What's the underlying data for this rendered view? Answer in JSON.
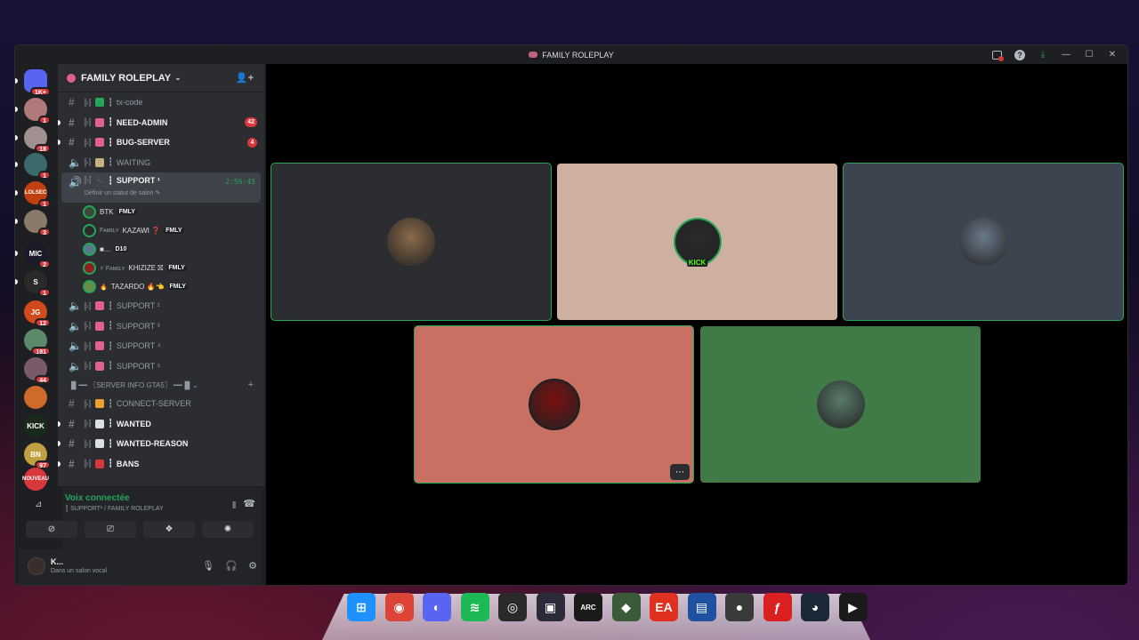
{
  "window": {
    "title": "FAMILY ROLEPLAY"
  },
  "servers": [
    {
      "name": "discord-home",
      "badge": "1K+",
      "color": "#5865f2",
      "label": ""
    },
    {
      "name": "server-1",
      "badge": "1",
      "color": "#b07a7a",
      "label": ""
    },
    {
      "name": "server-2",
      "badge": "18",
      "color": "#a09090",
      "label": ""
    },
    {
      "name": "server-3",
      "badge": "1",
      "color": "#3a6a6a",
      "label": ""
    },
    {
      "name": "server-lolsec",
      "badge": "1",
      "color": "#c04010",
      "label": "LOLSEC"
    },
    {
      "name": "server-5",
      "badge": "3",
      "color": "#8a7a6a",
      "label": ""
    },
    {
      "name": "server-mic",
      "badge": "2",
      "color": "#1a1a2a",
      "label": "MIC"
    },
    {
      "name": "server-s",
      "badge": "1",
      "color": "#2a2a2a",
      "label": "S"
    },
    {
      "name": "server-jg",
      "badge": "12",
      "color": "#d04a1a",
      "label": "JG"
    },
    {
      "name": "server-191",
      "badge": "191",
      "color": "#5a8a6a",
      "label": ""
    },
    {
      "name": "server-44",
      "badge": "44",
      "color": "#7a5a6a",
      "label": ""
    },
    {
      "name": "server-12",
      "badge": "",
      "color": "#d06a2a",
      "label": ""
    },
    {
      "name": "server-kick",
      "badge": "",
      "color": "#1a2a1a",
      "label": "KICK"
    },
    {
      "name": "server-97",
      "badge": "97",
      "color": "#c0a040",
      "label": "BN"
    },
    {
      "name": "server-nouveau",
      "badge": "",
      "color": "#da373c",
      "label": "NOUVEAU"
    }
  ],
  "sidebar": {
    "server_name": "FAMILY ROLEPLAY",
    "channels": [
      {
        "name": "tx-code",
        "type": "text",
        "bold": false,
        "emoji_color": "#23a55a",
        "count": ""
      },
      {
        "name": "NEED-ADMIN",
        "type": "text",
        "bold": true,
        "emoji_color": "#e06090",
        "count": "42"
      },
      {
        "name": "BUG-SERVER",
        "type": "text",
        "bold": true,
        "emoji_color": "#e06090",
        "count": "4"
      },
      {
        "name": "WAITING",
        "type": "voice",
        "bold": false,
        "emoji_color": "#c8b080",
        "count": ""
      }
    ],
    "active_channel": {
      "name": "SUPPORT ¹",
      "timer": "2:56:45",
      "status": "Définir un statut de salon ✎"
    },
    "voice_users": [
      {
        "name": "BTK",
        "tag": "FMLY",
        "color": "#3a4a3a"
      },
      {
        "name": "KAZAWI ❓",
        "prefix": "Fᴀᴍɪʟʏ",
        "tag": "FMLY",
        "color": "#2a2a2a"
      },
      {
        "name": "■...",
        "tag": "D10",
        "color": "#5a7a8a"
      },
      {
        "name": "KHIZIZE ⛝",
        "prefix": "⚡ Fᴀᴍɪʟʏ",
        "tag": "FMLY",
        "color": "#8a2020"
      },
      {
        "name": "TAZARDO 🔥👈",
        "prefix": "🔥",
        "tag": "FMLY",
        "color": "#6a8a4a"
      }
    ],
    "support_channels": [
      "SUPPORT ²",
      "SUPPORT ³",
      "SUPPORT ⁴",
      "SUPPORT ⁵"
    ],
    "category": "▐▌━━ 〖SERVER INFO GTA5〗 ━━▐▌",
    "info_channels": [
      {
        "name": "CONNECT-SERVER",
        "bold": false,
        "emoji_color": "#e8a030"
      },
      {
        "name": "WANTED",
        "bold": true,
        "emoji_color": "#dbdee1"
      },
      {
        "name": "WANTED-REASON",
        "bold": true,
        "emoji_color": "#dbdee1"
      },
      {
        "name": "BANS",
        "bold": true,
        "emoji_color": "#da373c"
      }
    ]
  },
  "voice_panel": {
    "title": "Voix connectée",
    "subtitle": "┇ SUPPORT¹ / FAMILY ROLEPLAY"
  },
  "user": {
    "name": "K...",
    "status": "Dans un salon vocal"
  },
  "tiles": [
    {
      "name": "tile-1",
      "bg": "#2b2d31",
      "speaking": true,
      "avatar_color": "#8a6a4a",
      "badge": ""
    },
    {
      "name": "tile-2",
      "bg": "#cdb0a0",
      "speaking": false,
      "avatar_color": "#2a2a2a",
      "badge": "KICK"
    },
    {
      "name": "tile-3",
      "bg": "#3c4450",
      "speaking": true,
      "avatar_color": "#6a7a8a",
      "badge": ""
    },
    {
      "name": "tile-4",
      "bg": "#c87062",
      "speaking": true,
      "avatar_color": "#7a1010",
      "badge": ""
    },
    {
      "name": "tile-5",
      "bg": "#3f7a47",
      "speaking": false,
      "avatar_color": "#5a7a6a",
      "badge": ""
    }
  ],
  "taskbar": [
    {
      "name": "windows-start-icon",
      "color": "#1e90ff",
      "glyph": "⊞"
    },
    {
      "name": "chrome-icon",
      "color": "#db4437",
      "glyph": "◉"
    },
    {
      "name": "discord-icon",
      "color": "#5865f2",
      "glyph": "◐"
    },
    {
      "name": "spotify-icon",
      "color": "#1db954",
      "glyph": "≋"
    },
    {
      "name": "obs-icon",
      "color": "#2a2a2a",
      "glyph": "◎"
    },
    {
      "name": "game-bar-icon",
      "color": "#2a2a3a",
      "glyph": "▣"
    },
    {
      "name": "arc-raiders-icon",
      "color": "#1a1a1a",
      "glyph": "ARC"
    },
    {
      "name": "app-green-icon",
      "color": "#3a5a3a",
      "glyph": "◆"
    },
    {
      "name": "ea-icon",
      "color": "#e03020",
      "glyph": "EA"
    },
    {
      "name": "pc-icon",
      "color": "#2050a0",
      "glyph": "▤"
    },
    {
      "name": "gta-icon",
      "color": "#3a3a3a",
      "glyph": "●"
    },
    {
      "name": "faceit-icon",
      "color": "#da2020",
      "glyph": "ƒ"
    },
    {
      "name": "steam-icon",
      "color": "#1b2838",
      "glyph": "◕"
    },
    {
      "name": "app-arrow-icon",
      "color": "#1a1a1a",
      "glyph": "▶"
    }
  ]
}
